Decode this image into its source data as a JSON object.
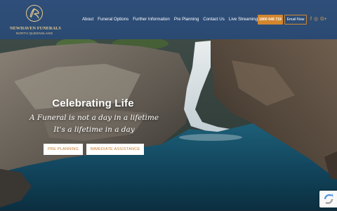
{
  "brand": {
    "name": "NEWHAVEN FUNERALS",
    "subname": "NORTH QUEENSLAND",
    "accent": "#d2872f",
    "header_bg": "#2f4f7a"
  },
  "nav": {
    "items": [
      {
        "label": "About"
      },
      {
        "label": "Funeral Options"
      },
      {
        "label": "Further Information"
      },
      {
        "label": "Pre Planning"
      },
      {
        "label": "Contact Us"
      },
      {
        "label": "Live Streaming"
      }
    ],
    "phone_label": "1800 649 719",
    "email_label": "Email Now",
    "social": [
      {
        "icon": "facebook-icon",
        "glyph": "f"
      },
      {
        "icon": "instagram-icon",
        "glyph": "◎"
      },
      {
        "icon": "google-plus-icon",
        "glyph": "G+"
      }
    ]
  },
  "hero": {
    "title": "Celebrating Life",
    "tagline_1": "A Funeral is not a day in a lifetime",
    "tagline_2": "It's a lifetime in a day",
    "pre_planning_label": "PRE PLANNING",
    "assistance_label": "IMMEDIATE ASSISTANCE"
  }
}
